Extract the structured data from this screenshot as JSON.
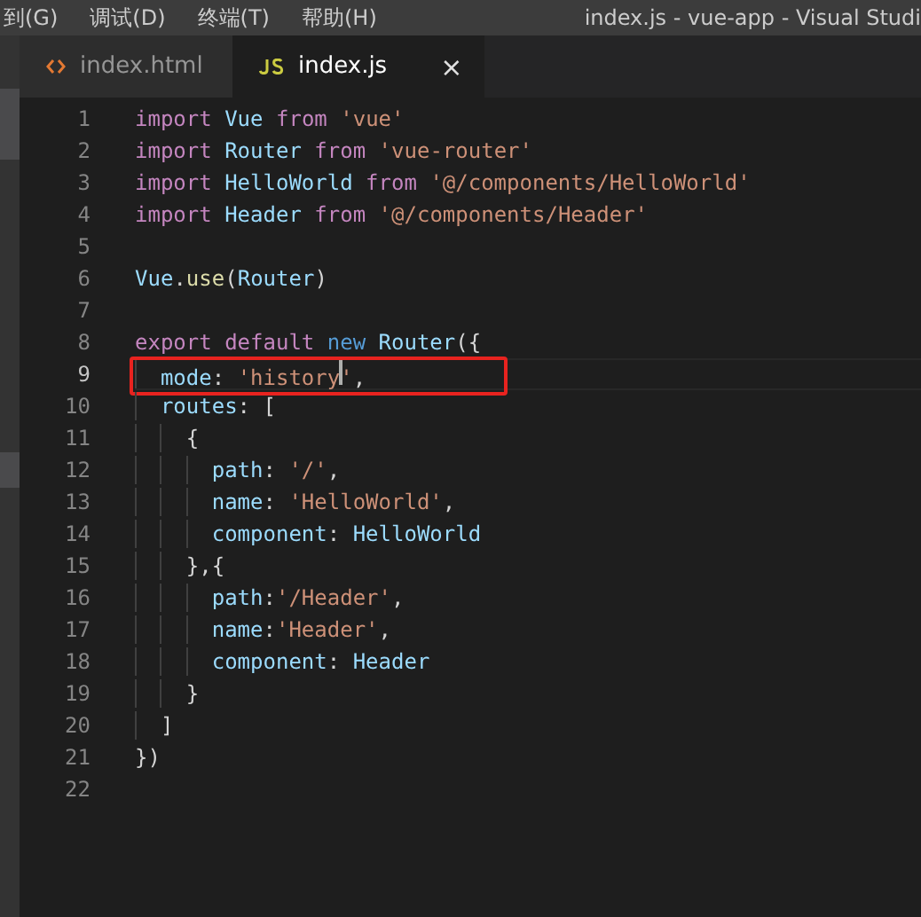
{
  "menu_bar": {
    "items": [
      "到(G)",
      "调试(D)",
      "终端(T)",
      "帮助(H)"
    ],
    "title": "index.js - vue-app - Visual Studi"
  },
  "tabs": [
    {
      "label": "index.html",
      "kind": "html",
      "selected": false,
      "closable": false
    },
    {
      "label": "index.js",
      "kind": "js",
      "selected": true,
      "closable": true,
      "close": "×"
    }
  ],
  "editor": {
    "lines": [
      {
        "number": "1",
        "current": false,
        "tokens": [
          {
            "text": "import ",
            "kind": "keyword"
          },
          {
            "text": "Vue",
            "kind": "ident"
          },
          {
            "text": " from ",
            "kind": "keyword"
          },
          {
            "text": "'vue'",
            "kind": "string"
          }
        ]
      },
      {
        "number": "2",
        "current": false,
        "tokens": [
          {
            "text": "import ",
            "kind": "keyword"
          },
          {
            "text": "Router",
            "kind": "ident"
          },
          {
            "text": " from ",
            "kind": "keyword"
          },
          {
            "text": "'vue-router'",
            "kind": "string"
          }
        ]
      },
      {
        "number": "3",
        "current": false,
        "tokens": [
          {
            "text": "import ",
            "kind": "keyword"
          },
          {
            "text": "HelloWorld",
            "kind": "ident"
          },
          {
            "text": " from ",
            "kind": "keyword"
          },
          {
            "text": "'@/components/HelloWorld'",
            "kind": "string"
          }
        ]
      },
      {
        "number": "4",
        "current": false,
        "tokens": [
          {
            "text": "import ",
            "kind": "keyword"
          },
          {
            "text": "Header",
            "kind": "ident"
          },
          {
            "text": " from ",
            "kind": "keyword"
          },
          {
            "text": "'@/components/Header'",
            "kind": "string"
          }
        ]
      },
      {
        "number": "5",
        "current": false
      },
      {
        "number": "6",
        "current": false,
        "tokens": [
          {
            "text": "Vue",
            "kind": "ident"
          },
          {
            "text": ".",
            "kind": "plain"
          },
          {
            "text": "use",
            "kind": "function"
          },
          {
            "text": "(",
            "kind": "plain"
          },
          {
            "text": "Router",
            "kind": "ident"
          },
          {
            "text": ")",
            "kind": "plain"
          }
        ]
      },
      {
        "number": "7",
        "current": false
      },
      {
        "number": "8",
        "current": false,
        "tokens": [
          {
            "text": "export default ",
            "kind": "keyword"
          },
          {
            "text": "new ",
            "kind": "storage"
          },
          {
            "text": "Router",
            "kind": "ident"
          },
          {
            "text": "({",
            "kind": "plain"
          }
        ]
      },
      {
        "number": "9",
        "current": true,
        "annotated": true,
        "tokens": [
          {
            "text": "  mode",
            "kind": "ident"
          },
          {
            "text": ": ",
            "kind": "plain"
          },
          {
            "text": "'history",
            "kind": "string"
          },
          {
            "kind": "cursor"
          },
          {
            "text": "'",
            "kind": "string"
          },
          {
            "text": ",",
            "kind": "plain"
          }
        ]
      },
      {
        "number": "10",
        "current": false,
        "tokens": [
          {
            "text": "  routes",
            "kind": "ident"
          },
          {
            "text": ": [",
            "kind": "plain"
          }
        ]
      },
      {
        "number": "11",
        "current": false,
        "tokens": [
          {
            "text": "    {",
            "kind": "plain"
          }
        ]
      },
      {
        "number": "12",
        "current": false,
        "tokens": [
          {
            "text": "      path",
            "kind": "ident"
          },
          {
            "text": ": ",
            "kind": "plain"
          },
          {
            "text": "'/'",
            "kind": "string"
          },
          {
            "text": ",",
            "kind": "plain"
          }
        ]
      },
      {
        "number": "13",
        "current": false,
        "tokens": [
          {
            "text": "      name",
            "kind": "ident"
          },
          {
            "text": ": ",
            "kind": "plain"
          },
          {
            "text": "'HelloWorld'",
            "kind": "string"
          },
          {
            "text": ",",
            "kind": "plain"
          }
        ]
      },
      {
        "number": "14",
        "current": false,
        "tokens": [
          {
            "text": "      component",
            "kind": "ident"
          },
          {
            "text": ": ",
            "kind": "plain"
          },
          {
            "text": "HelloWorld",
            "kind": "ident"
          }
        ]
      },
      {
        "number": "15",
        "current": false,
        "tokens": [
          {
            "text": "    },{",
            "kind": "plain"
          }
        ]
      },
      {
        "number": "16",
        "current": false,
        "tokens": [
          {
            "text": "      path",
            "kind": "ident"
          },
          {
            "text": ":",
            "kind": "plain"
          },
          {
            "text": "'/Header'",
            "kind": "string"
          },
          {
            "text": ",",
            "kind": "plain"
          }
        ]
      },
      {
        "number": "17",
        "current": false,
        "tokens": [
          {
            "text": "      name",
            "kind": "ident"
          },
          {
            "text": ":",
            "kind": "plain"
          },
          {
            "text": "'Header'",
            "kind": "string"
          },
          {
            "text": ",",
            "kind": "plain"
          }
        ]
      },
      {
        "number": "18",
        "current": false,
        "tokens": [
          {
            "text": "      component",
            "kind": "ident"
          },
          {
            "text": ": ",
            "kind": "plain"
          },
          {
            "text": "Header",
            "kind": "ident"
          }
        ]
      },
      {
        "number": "19",
        "current": false,
        "tokens": [
          {
            "text": "    }",
            "kind": "plain"
          }
        ]
      },
      {
        "number": "20",
        "current": false,
        "tokens": [
          {
            "text": "  ]",
            "kind": "plain"
          }
        ]
      },
      {
        "number": "21",
        "current": false,
        "tokens": [
          {
            "text": "})",
            "kind": "plain"
          }
        ]
      },
      {
        "number": "22",
        "current": false
      }
    ]
  }
}
